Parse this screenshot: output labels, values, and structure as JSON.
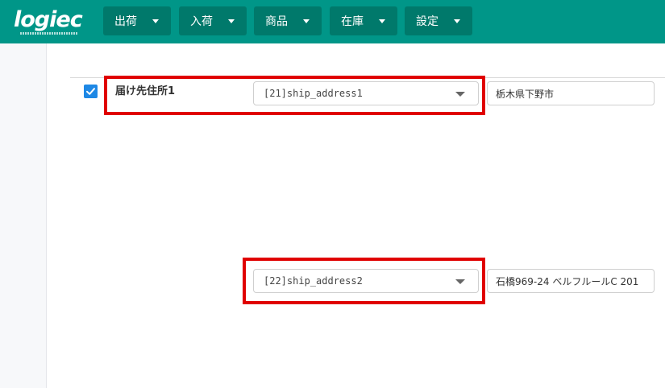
{
  "app": {
    "logo_text": "logiec",
    "nav": [
      {
        "label": "出荷"
      },
      {
        "label": "入荷"
      },
      {
        "label": "商品"
      },
      {
        "label": "在庫"
      },
      {
        "label": "設定"
      }
    ]
  },
  "mapping": {
    "field_label": "届け先住所1",
    "checkbox_checked": true,
    "row1": {
      "select_value": "[21]ship_address1",
      "input_value": "栃木県下野市"
    },
    "row2": {
      "select_value": "[22]ship_address2",
      "input_value": "石橋969-24 ベルフルールC 201"
    }
  },
  "colors": {
    "header": "#009688",
    "nav_button": "#00796b",
    "checkbox": "#1e88e5",
    "highlight": "#e00000"
  },
  "icons": {
    "nav_caret": "caret-down-icon",
    "select_caret": "caret-down-icon",
    "checkbox_check": "checkmark-icon"
  }
}
